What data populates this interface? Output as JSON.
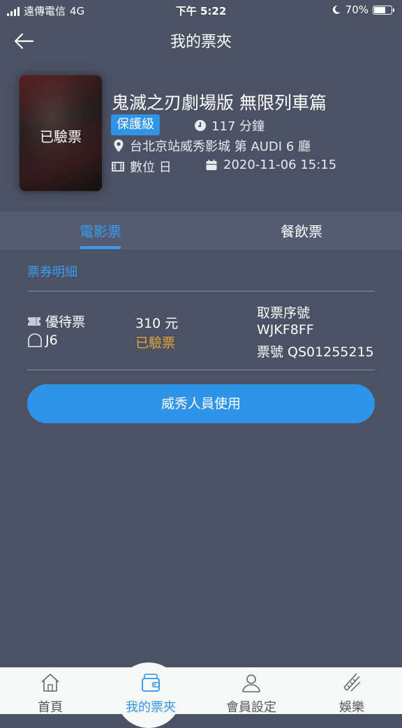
{
  "status_bar": {
    "carrier": "遠傳電信",
    "network": "4G",
    "time": "下午 5:22",
    "battery": "70%",
    "battery_level": 0.7
  },
  "header": {
    "title": "我的票夾"
  },
  "movie": {
    "poster_status": "已驗票",
    "title": "鬼滅之刃劇場版 無限列車篇",
    "rating": "保護級",
    "duration": "117 分鐘",
    "cinema": "台北京站威秀影城 第 AUDI 6 廳",
    "format": "數位 日",
    "datetime": "2020-11-06 15:15"
  },
  "tabs": [
    {
      "label": "電影票",
      "active": true
    },
    {
      "label": "餐飲票",
      "active": false
    }
  ],
  "details": {
    "section_title": "票券明細",
    "ticket_type": "優待票",
    "seat": "J6",
    "price": "310 元",
    "ticket_status": "已驗票",
    "pickup_label": "取票序號",
    "pickup_code": "WJKF8FF",
    "ticket_number": "票號 QS01255215"
  },
  "actions": {
    "staff_button": "威秀人員使用"
  },
  "bottom_nav": [
    {
      "label": "首頁",
      "icon": "home-icon",
      "active": false
    },
    {
      "label": "我的票夾",
      "icon": "wallet-icon",
      "active": true
    },
    {
      "label": "會員設定",
      "icon": "user-icon",
      "active": false
    },
    {
      "label": "娛樂",
      "icon": "entertainment-icon",
      "active": false
    }
  ],
  "colors": {
    "background": "#4b5263",
    "accent": "#2f93e8",
    "status_checked": "#e3a33b"
  }
}
